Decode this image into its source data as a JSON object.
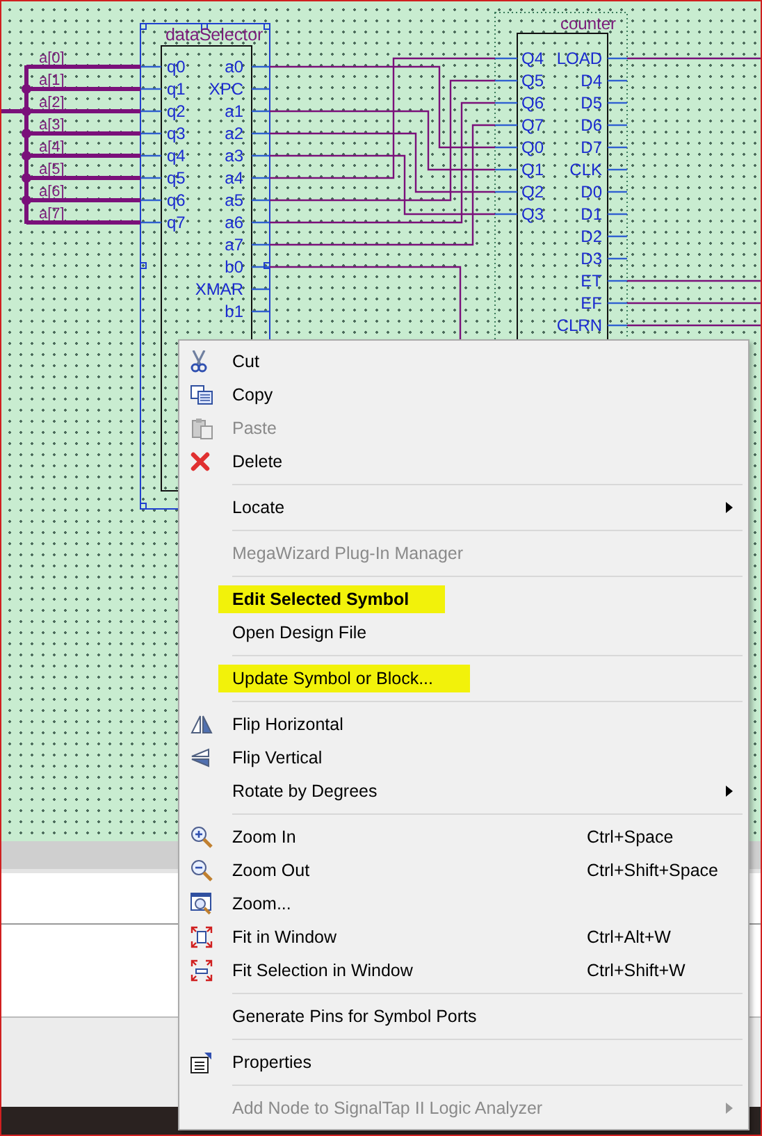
{
  "schematic": {
    "bus_labels": [
      "a[0]",
      "a[1]",
      "a[2]",
      "a[3]",
      "a[4]",
      "a[5]",
      "a[6]",
      "a[7]"
    ],
    "selector": {
      "title": "dataSelector",
      "inputs": [
        "q0",
        "q1",
        "q2",
        "q3",
        "q4",
        "q5",
        "q6",
        "q7"
      ],
      "outputs": [
        "a0",
        "XPC",
        "a1",
        "a2",
        "a3",
        "a4",
        "a5",
        "a6",
        "a7",
        "b0",
        "XMAR",
        "b1"
      ]
    },
    "counter": {
      "title": "counter",
      "inputs": [
        "Q4",
        "Q5",
        "Q6",
        "Q7",
        "Q0",
        "Q1",
        "Q2",
        "Q3"
      ],
      "outputs": [
        "LOAD",
        "D4",
        "D5",
        "D6",
        "D7",
        "CLK",
        "D0",
        "D1",
        "D2",
        "D3",
        "ET",
        "EF",
        "CLRN"
      ]
    }
  },
  "context_menu": {
    "items": [
      {
        "kind": "item",
        "label": "Cut",
        "disabled": false,
        "default": false,
        "highlighted": false,
        "submenu": false
      },
      {
        "kind": "item",
        "label": "Copy",
        "disabled": false,
        "default": false,
        "highlighted": false,
        "submenu": false
      },
      {
        "kind": "item",
        "label": "Paste",
        "disabled": true,
        "default": false,
        "highlighted": false,
        "submenu": false
      },
      {
        "kind": "item",
        "label": "Delete",
        "disabled": false,
        "default": false,
        "highlighted": false,
        "submenu": false
      },
      {
        "kind": "separator"
      },
      {
        "kind": "item",
        "label": "Locate",
        "disabled": false,
        "default": false,
        "highlighted": false,
        "submenu": true
      },
      {
        "kind": "separator"
      },
      {
        "kind": "item",
        "label": "MegaWizard Plug-In Manager",
        "disabled": true,
        "default": false,
        "highlighted": false,
        "submenu": false
      },
      {
        "kind": "separator"
      },
      {
        "kind": "item",
        "label": "Edit Selected Symbol",
        "disabled": false,
        "default": true,
        "highlighted": true,
        "submenu": false
      },
      {
        "kind": "item",
        "label": "Open Design File",
        "disabled": false,
        "default": false,
        "highlighted": false,
        "submenu": false
      },
      {
        "kind": "separator"
      },
      {
        "kind": "item",
        "label": "Update Symbol or Block...",
        "disabled": false,
        "default": false,
        "highlighted": true,
        "submenu": false
      },
      {
        "kind": "separator"
      },
      {
        "kind": "item",
        "label": "Flip Horizontal",
        "disabled": false,
        "default": false,
        "highlighted": false,
        "submenu": false
      },
      {
        "kind": "item",
        "label": "Flip Vertical",
        "disabled": false,
        "default": false,
        "highlighted": false,
        "submenu": false
      },
      {
        "kind": "item",
        "label": "Rotate by Degrees",
        "disabled": false,
        "default": false,
        "highlighted": false,
        "submenu": true
      },
      {
        "kind": "separator"
      },
      {
        "kind": "item",
        "label": "Zoom In",
        "shortcut": "Ctrl+Space",
        "disabled": false,
        "default": false,
        "highlighted": false,
        "submenu": false
      },
      {
        "kind": "item",
        "label": "Zoom Out",
        "shortcut": "Ctrl+Shift+Space",
        "disabled": false,
        "default": false,
        "highlighted": false,
        "submenu": false
      },
      {
        "kind": "item",
        "label": "Zoom...",
        "disabled": false,
        "default": false,
        "highlighted": false,
        "submenu": false
      },
      {
        "kind": "item",
        "label": "Fit in Window",
        "shortcut": "Ctrl+Alt+W",
        "disabled": false,
        "default": false,
        "highlighted": false,
        "submenu": false
      },
      {
        "kind": "item",
        "label": "Fit Selection in Window",
        "shortcut": "Ctrl+Shift+W",
        "disabled": false,
        "default": false,
        "highlighted": false,
        "submenu": false
      },
      {
        "kind": "separator"
      },
      {
        "kind": "item",
        "label": "Generate Pins for Symbol Ports",
        "disabled": false,
        "default": false,
        "highlighted": false,
        "submenu": false
      },
      {
        "kind": "separator"
      },
      {
        "kind": "item",
        "label": "Properties",
        "disabled": false,
        "default": false,
        "highlighted": false,
        "submenu": false
      },
      {
        "kind": "separator"
      },
      {
        "kind": "item",
        "label": "Add Node to SignalTap II Logic Analyzer",
        "disabled": true,
        "default": false,
        "highlighted": false,
        "submenu": true
      }
    ]
  }
}
